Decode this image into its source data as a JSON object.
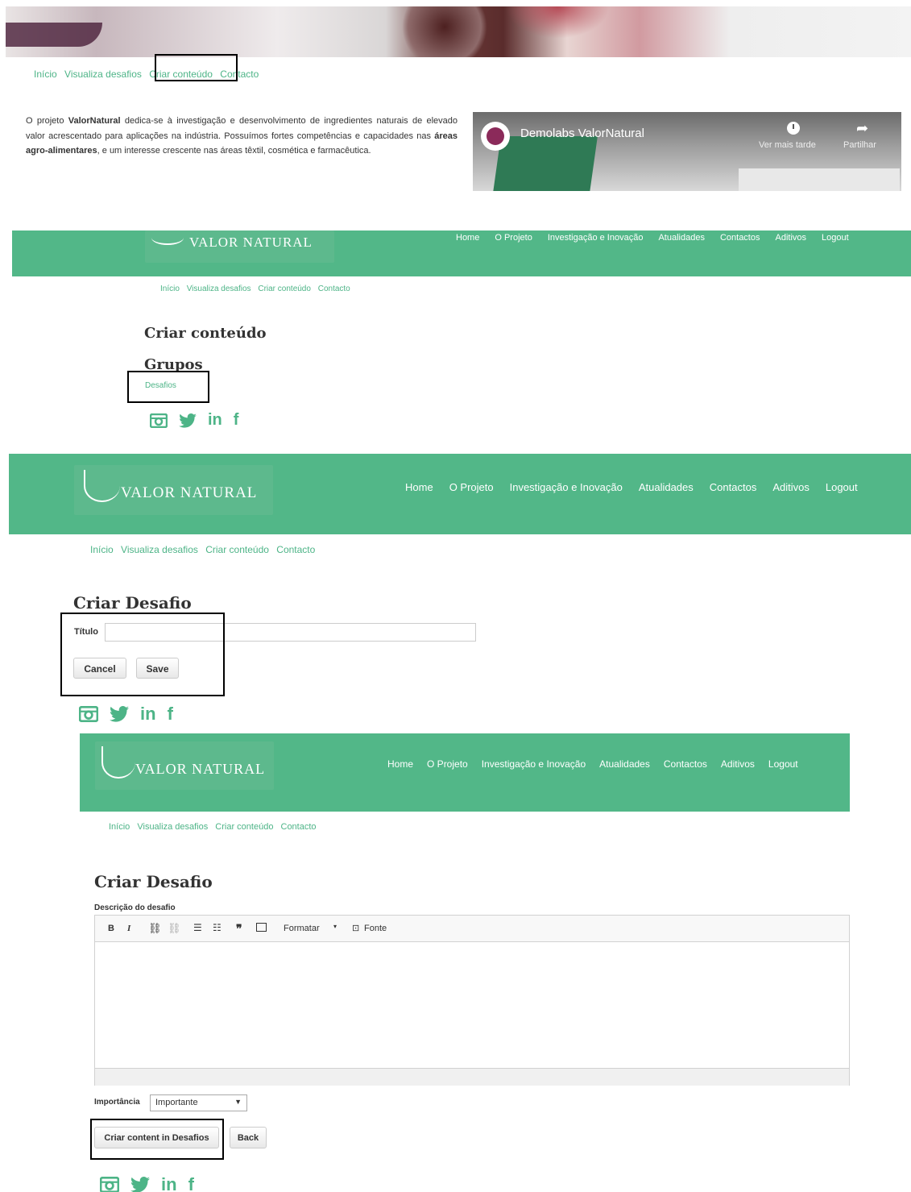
{
  "section1": {
    "nav": [
      "Início",
      "Visualiza desafios",
      "Criar conteúdo",
      "Contacto"
    ],
    "intro_p1": "O projeto ",
    "intro_bold1": "ValorNatural",
    "intro_p2": " dedica-se à investigação e desenvolvimento de ingredientes naturais de elevado valor acrescentado para aplicações na indústria. Possuímos fortes competências e capacidades nas ",
    "intro_bold2": "áreas agro-alimentares",
    "intro_p3": ", e um interesse crescente nas áreas têxtil, cosmética e farmacêutica.",
    "video_title": "Demolabs ValorNatural",
    "video_watch_later": "Ver mais tarde",
    "video_share": "Partilhar"
  },
  "logo_text": "VALOR NATURAL",
  "menu": [
    "Home",
    "O Projeto",
    "Investigação e Inovação",
    "Atualidades",
    "Contactos",
    "Aditivos",
    "Logout"
  ],
  "nav": [
    "Início",
    "Visualiza desafios",
    "Criar conteúdo",
    "Contacto"
  ],
  "section2": {
    "title": "Criar conteúdo",
    "groups_title": "Grupos",
    "group_link": "Desafios"
  },
  "section3": {
    "title": "Criar Desafio",
    "titulo_label": "Título",
    "titulo_value": "",
    "cancel": "Cancel",
    "save": "Save"
  },
  "section4": {
    "title": "Criar Desafio",
    "descricao_label": "Descrição do desafio",
    "toolbar": {
      "bold": "B",
      "italic": "I",
      "format": "Formatar",
      "source": "Fonte"
    },
    "importancia_label": "Importância",
    "importancia_value": "Importante",
    "submit": "Criar content in Desafios",
    "back": "Back"
  },
  "social": {
    "linkedin": "in",
    "facebook": "f"
  },
  "colors": {
    "brand_green": "#52b788",
    "link_green": "#4db487"
  }
}
